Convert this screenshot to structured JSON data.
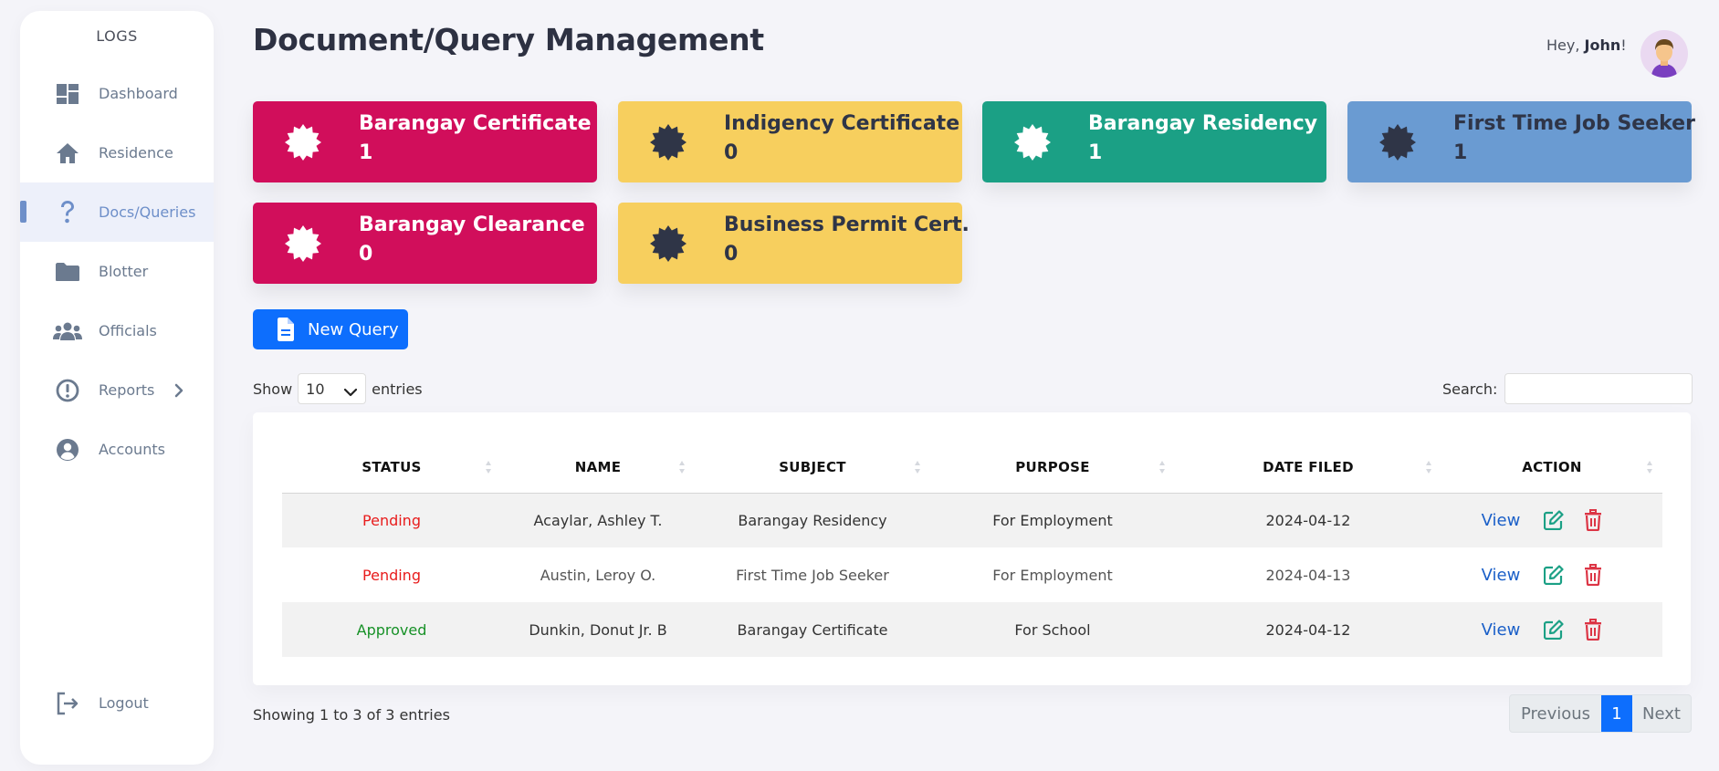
{
  "sidebar": {
    "brand": "LOGS",
    "items": [
      {
        "label": "Dashboard",
        "icon": "dashboard-icon"
      },
      {
        "label": "Residence",
        "icon": "home-icon"
      },
      {
        "label": "Docs/Queries",
        "icon": "question-icon",
        "active": true
      },
      {
        "label": "Blotter",
        "icon": "folder-icon"
      },
      {
        "label": "Officials",
        "icon": "users-icon"
      },
      {
        "label": "Reports",
        "icon": "alert-icon"
      },
      {
        "label": "Accounts",
        "icon": "user-circle-icon"
      }
    ],
    "logout": "Logout"
  },
  "header": {
    "title": "Document/Query Management",
    "greeting_prefix": "Hey, ",
    "user_name": "John",
    "greeting_suffix": "!"
  },
  "cards": [
    {
      "title": "Barangay Certificate",
      "count": "1",
      "color": "#d10e5b"
    },
    {
      "title": "Indigency Certificate",
      "count": "0",
      "color": "#f7cf5e"
    },
    {
      "title": "Barangay Residency",
      "count": "1",
      "color": "#1ba085"
    },
    {
      "title": "First Time Job Seeker",
      "count": "1",
      "color": "#6a9bd2"
    },
    {
      "title": "Barangay Clearance",
      "count": "0",
      "color": "#d10e5b"
    },
    {
      "title": "Business Permit Cert.",
      "count": "0",
      "color": "#f7cf5e"
    }
  ],
  "new_query_label": "New Query",
  "table_controls": {
    "show_label": "Show",
    "entries_value": "10",
    "entries_label": "entries",
    "search_label": "Search:",
    "search_value": ""
  },
  "table": {
    "columns": [
      "STATUS",
      "NAME",
      "SUBJECT",
      "PURPOSE",
      "DATE FILED",
      "ACTION"
    ],
    "rows": [
      {
        "status": "Pending",
        "name": "Acaylar, Ashley T.",
        "subject": "Barangay Residency",
        "purpose": "For Employment",
        "date": "2024-04-12",
        "view": "View"
      },
      {
        "status": "Pending",
        "name": "Austin, Leroy O.",
        "subject": "First Time Job Seeker",
        "purpose": "For Employment",
        "date": "2024-04-13",
        "view": "View"
      },
      {
        "status": "Approved",
        "name": "Dunkin, Donut Jr. B",
        "subject": "Barangay Certificate",
        "purpose": "For School",
        "date": "2024-04-12",
        "view": "View"
      }
    ]
  },
  "footer": {
    "info": "Showing 1 to 3 of 3 entries",
    "prev": "Previous",
    "page": "1",
    "next": "Next"
  }
}
